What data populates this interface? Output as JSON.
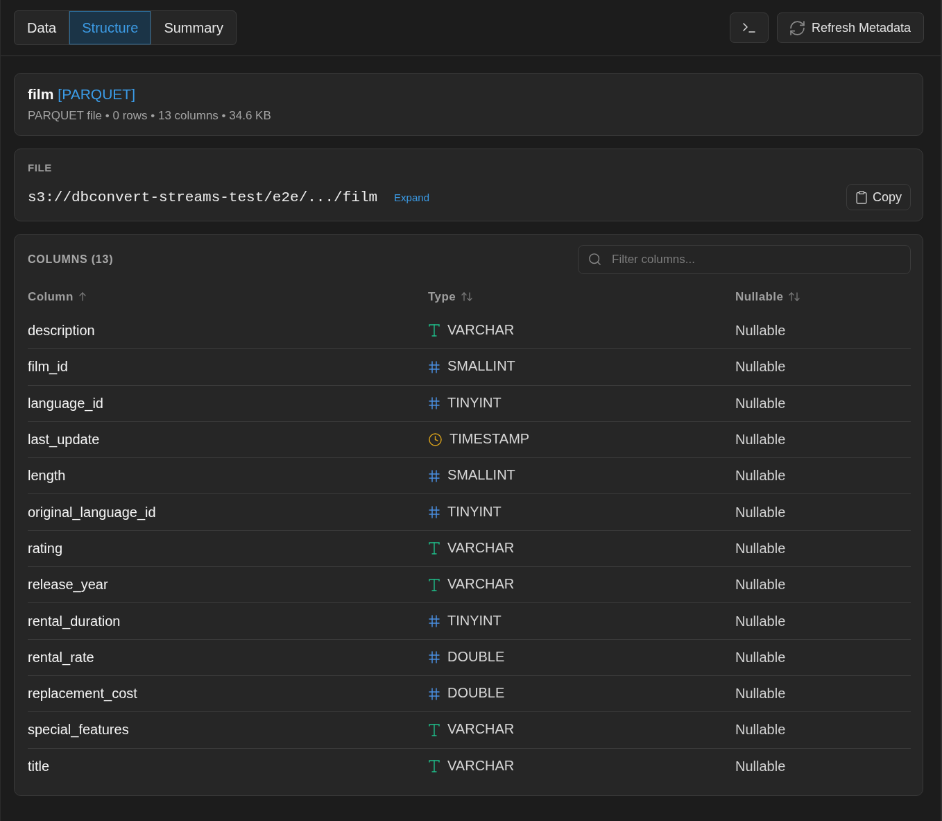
{
  "toolbar": {
    "tabs": [
      {
        "label": "Data",
        "selected": false
      },
      {
        "label": "Structure",
        "selected": true
      },
      {
        "label": "Summary",
        "selected": false
      }
    ],
    "actions": [
      {
        "kind": "terminal"
      },
      {
        "kind": "refresh",
        "label": "Refresh Metadata"
      }
    ]
  },
  "summary": {
    "name": "film",
    "format_tag": "[PARQUET]",
    "meta": "PARQUET file • 0 rows • 13 columns • 34.6 KB"
  },
  "file": {
    "label": "FILE",
    "path": "s3://dbconvert-streams-test/e2e/.../film",
    "expand_link": "Expand",
    "copy_button": "Copy"
  },
  "columns": {
    "title": "COLUMNS (13)",
    "filter": {
      "placeholder": "Filter columns..."
    },
    "headers": [
      {
        "label": "Column",
        "sorted": true
      },
      {
        "label": "Type",
        "sorted": false
      },
      {
        "label": "Nullable",
        "sorted": false
      }
    ],
    "rows": [
      {
        "name": "description",
        "type": "VARCHAR",
        "kind": "text",
        "nullable": "Nullable"
      },
      {
        "name": "film_id",
        "type": "SMALLINT",
        "kind": "number",
        "nullable": "Nullable"
      },
      {
        "name": "language_id",
        "type": "TINYINT",
        "kind": "number",
        "nullable": "Nullable"
      },
      {
        "name": "last_update",
        "type": "TIMESTAMP",
        "kind": "time",
        "nullable": "Nullable"
      },
      {
        "name": "length",
        "type": "SMALLINT",
        "kind": "number",
        "nullable": "Nullable"
      },
      {
        "name": "original_language_id",
        "type": "TINYINT",
        "kind": "number",
        "nullable": "Nullable"
      },
      {
        "name": "rating",
        "type": "VARCHAR",
        "kind": "text",
        "nullable": "Nullable"
      },
      {
        "name": "release_year",
        "type": "VARCHAR",
        "kind": "text",
        "nullable": "Nullable"
      },
      {
        "name": "rental_duration",
        "type": "TINYINT",
        "kind": "number",
        "nullable": "Nullable"
      },
      {
        "name": "rental_rate",
        "type": "DOUBLE",
        "kind": "number",
        "nullable": "Nullable"
      },
      {
        "name": "replacement_cost",
        "type": "DOUBLE",
        "kind": "number",
        "nullable": "Nullable"
      },
      {
        "name": "special_features",
        "type": "VARCHAR",
        "kind": "text",
        "nullable": "Nullable"
      },
      {
        "name": "title",
        "type": "VARCHAR",
        "kind": "text",
        "nullable": "Nullable"
      }
    ]
  }
}
